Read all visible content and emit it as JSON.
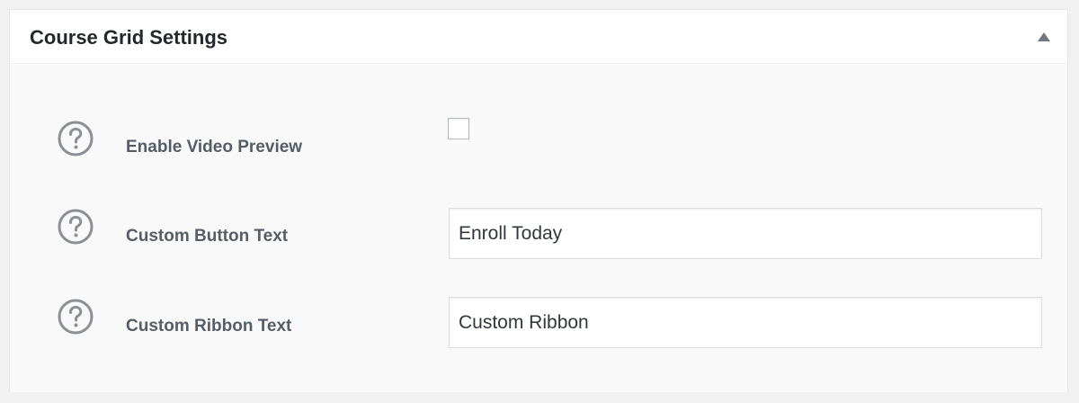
{
  "panel": {
    "title": "Course Grid Settings",
    "toggle_icon": "triangle-up-icon"
  },
  "fields": {
    "video_preview": {
      "label": "Enable Video Preview",
      "checked": false,
      "help_icon": "question-circle-icon"
    },
    "button_text": {
      "label": "Custom Button Text",
      "value": "Enroll Today",
      "help_icon": "question-circle-icon"
    },
    "ribbon_text": {
      "label": "Custom Ribbon Text",
      "value": "Custom Ribbon",
      "help_icon": "question-circle-icon"
    }
  },
  "colors": {
    "title_text": "#23282d",
    "label_text": "#555d66",
    "help_icon": "#8c8f94",
    "body_background": "#f9f9f9"
  }
}
